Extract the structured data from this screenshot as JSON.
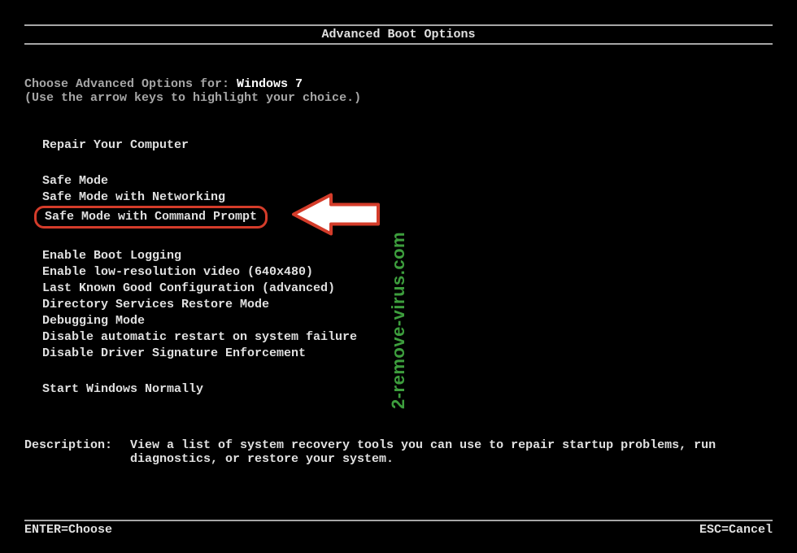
{
  "title": "Advanced Boot Options",
  "header": {
    "prefix": "Choose Advanced Options for: ",
    "os": "Windows 7",
    "hint": "(Use the arrow keys to highlight your choice.)"
  },
  "groups": [
    {
      "items": [
        {
          "label": "Repair Your Computer",
          "highlighted": false
        }
      ]
    },
    {
      "items": [
        {
          "label": "Safe Mode",
          "highlighted": false
        },
        {
          "label": "Safe Mode with Networking",
          "highlighted": false
        },
        {
          "label": "Safe Mode with Command Prompt",
          "highlighted": true
        }
      ]
    },
    {
      "items": [
        {
          "label": "Enable Boot Logging",
          "highlighted": false
        },
        {
          "label": "Enable low-resolution video (640x480)",
          "highlighted": false
        },
        {
          "label": "Last Known Good Configuration (advanced)",
          "highlighted": false
        },
        {
          "label": "Directory Services Restore Mode",
          "highlighted": false
        },
        {
          "label": "Debugging Mode",
          "highlighted": false
        },
        {
          "label": "Disable automatic restart on system failure",
          "highlighted": false
        },
        {
          "label": "Disable Driver Signature Enforcement",
          "highlighted": false
        }
      ]
    },
    {
      "items": [
        {
          "label": "Start Windows Normally",
          "highlighted": false
        }
      ]
    }
  ],
  "description": {
    "label": "Description:",
    "text": "View a list of system recovery tools you can use to repair startup problems, run diagnostics, or restore your system."
  },
  "footer": {
    "left": "ENTER=Choose",
    "right": "ESC=Cancel"
  },
  "watermark": "2-remove-virus.com",
  "colors": {
    "highlight_border": "#d43c2a",
    "watermark": "#3d9e3d"
  }
}
